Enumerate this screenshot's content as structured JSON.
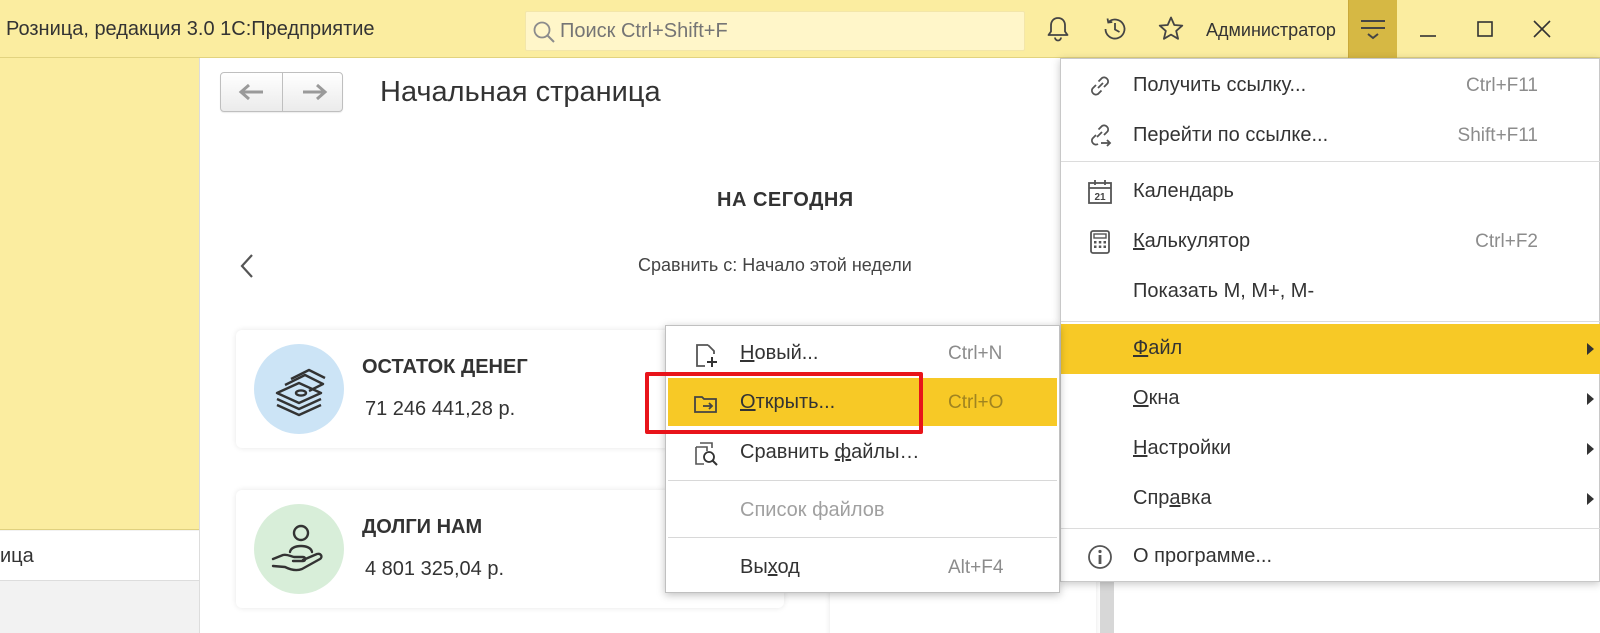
{
  "titlebar": {
    "app_title": "Розница, редакция 3.0 1С:Предприятие",
    "search_placeholder": "Поиск Ctrl+Shift+F",
    "user": "Администратор"
  },
  "sidebar": {
    "items": [
      {
        "label": "ица"
      }
    ]
  },
  "main": {
    "page_title": "Начальная страница",
    "section_heading": "НА СЕГОДНЯ",
    "compare_label": "Сравнить с: Начало этой недели",
    "cards": [
      {
        "title": "ОСТАТОК ДЕНЕГ",
        "value": "71 246 441,28 р.",
        "icon": "money-stack-icon",
        "color": "#cce4f6"
      },
      {
        "title": "ДОЛГИ НАМ",
        "value": "4 801 325,04 р.",
        "icon": "hand-person-icon",
        "color": "#d8eed9"
      }
    ]
  },
  "main_menu": {
    "items": [
      {
        "label": "Получить ссылку...",
        "shortcut": "Ctrl+F11",
        "icon": "link-icon"
      },
      {
        "label": "Перейти по ссылке...",
        "shortcut": "Shift+F11",
        "icon": "goto-link-icon"
      },
      {
        "label": "Календарь",
        "shortcut": "",
        "icon": "calendar-icon",
        "calendar_day": "21"
      },
      {
        "label": "Калькулятор",
        "shortcut": "Ctrl+F2",
        "icon": "calculator-icon"
      },
      {
        "label": "Показать M, M+, M-",
        "shortcut": ""
      },
      {
        "label": "Файл",
        "submenu": true,
        "active": true
      },
      {
        "label": "Окна",
        "submenu": true
      },
      {
        "label": "Настройки",
        "submenu": true
      },
      {
        "label": "Справка",
        "submenu": true
      },
      {
        "label": "О программе...",
        "icon": "info-icon"
      }
    ]
  },
  "file_submenu": {
    "items": [
      {
        "label": "Новый...",
        "shortcut": "Ctrl+N",
        "icon": "new-file-icon"
      },
      {
        "label": "Открыть...",
        "shortcut": "Ctrl+O",
        "icon": "open-folder-icon",
        "active": true
      },
      {
        "label": "Сравнить файлы...",
        "shortcut": "",
        "icon": "compare-files-icon"
      },
      {
        "label": "Список файлов",
        "shortcut": "",
        "disabled": true
      },
      {
        "label": "Выход",
        "shortcut": "Alt+F4"
      }
    ]
  },
  "colors": {
    "titlebar_bg": "#fbeda0",
    "menu_button_bg": "#d6b844",
    "highlight": "#f7c926",
    "annotation_red": "#e8141a"
  }
}
